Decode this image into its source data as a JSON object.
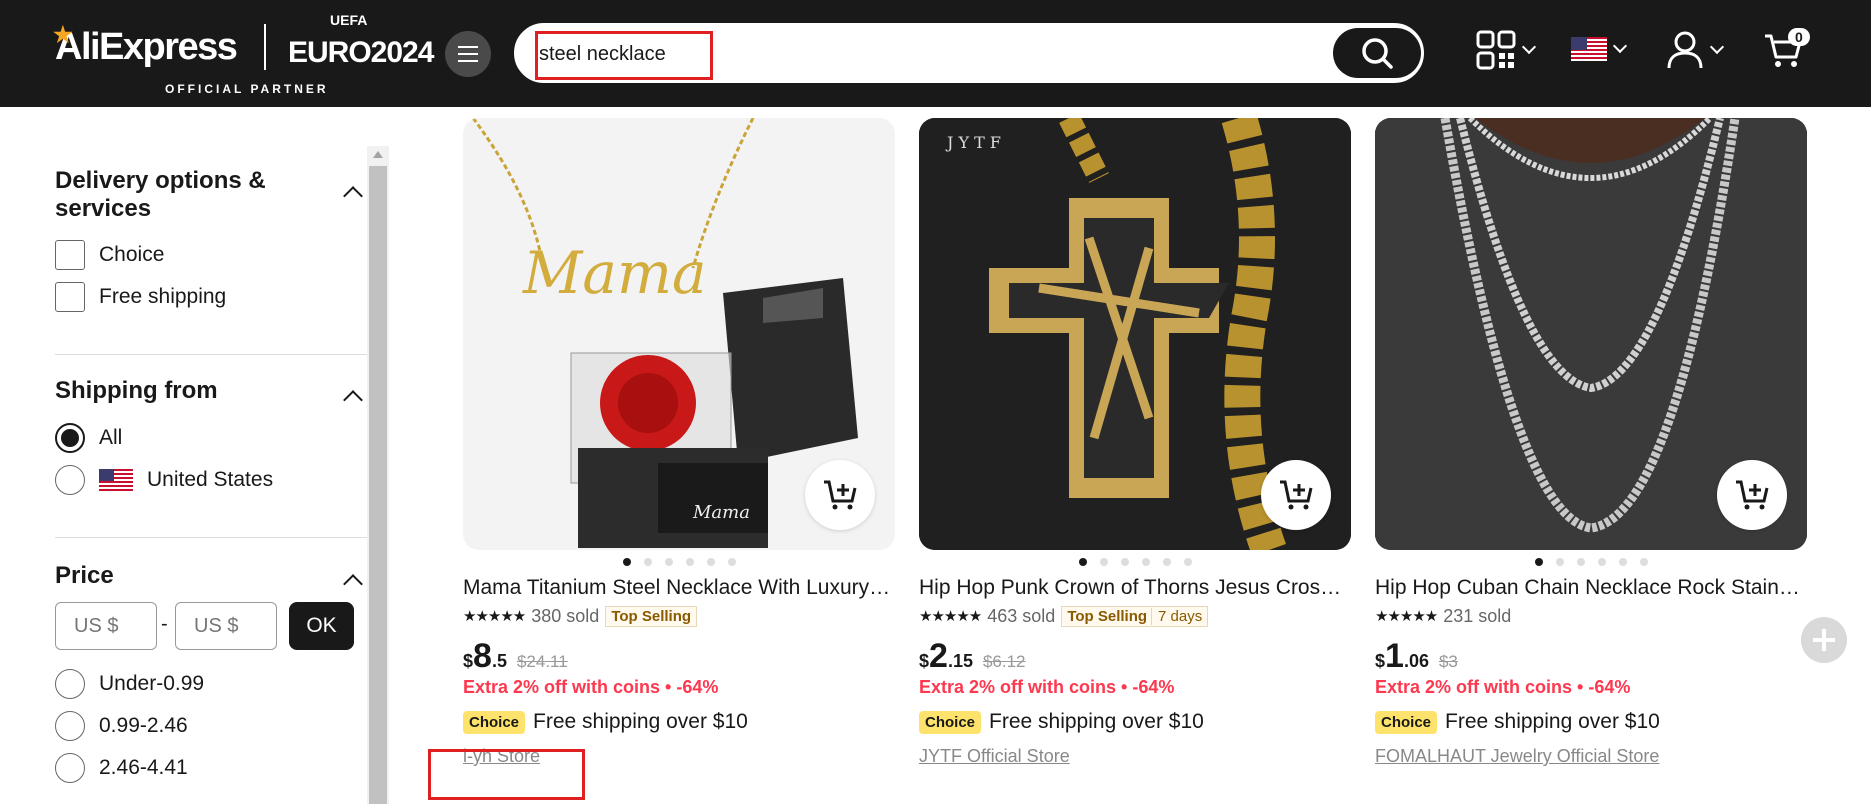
{
  "header": {
    "logo_text": "AliExpress",
    "euro_text": "EURO2024",
    "uefa_text": "UEFA",
    "partner_text": "OFFICIAL PARTNER",
    "search_value": "steel necklace",
    "cart_count": "0",
    "icons": [
      "menu-icon",
      "search-icon",
      "qr-code-icon",
      "us-flag-icon",
      "user-icon",
      "cart-icon"
    ]
  },
  "sidebar": {
    "delivery": {
      "title": "Delivery options & services",
      "options": [
        "Choice",
        "Free shipping"
      ]
    },
    "shipping_from": {
      "title": "Shipping from",
      "options": [
        "All",
        "United States"
      ],
      "selected": "All"
    },
    "price": {
      "title": "Price",
      "min_placeholder": "US $",
      "max_placeholder": "US $",
      "dash": "-",
      "ok_label": "OK",
      "ranges": [
        "Under-0.99",
        "0.99-2.46",
        "2.46-4.41"
      ]
    }
  },
  "products": [
    {
      "title": "Mama Titanium Steel Necklace With Luxury Gift Box Mother's Day",
      "rating_stars": "★★★★★",
      "sold": "380 sold",
      "tag": "Top Selling",
      "tag_extra": "",
      "currency": "$",
      "price_int": "8",
      "price_dec": ".5",
      "old_price": "$24.11",
      "coins": "Extra 2% off with coins • -64%",
      "choice": "Choice",
      "shipping": "Free shipping over $10",
      "store": "l-yh Store"
    },
    {
      "title": "Hip Hop Punk Crown of Thorns Jesus Cross Pendant Necklace",
      "rating_stars": "★★★★★",
      "sold": "463 sold",
      "tag": "Top Selling",
      "tag_extra": "7 days",
      "currency": "$",
      "price_int": "2",
      "price_dec": ".15",
      "old_price": "$6.12",
      "coins": "Extra 2% off with coins • -64%",
      "choice": "Choice",
      "shipping": "Free shipping over $10",
      "store": "JYTF Official Store"
    },
    {
      "title": "Hip Hop Cuban Chain Necklace Rock Stainless Steel Men Jewelry",
      "rating_stars": "★★★★★",
      "sold": "231 sold",
      "tag": "",
      "tag_extra": "",
      "currency": "$",
      "price_int": "1",
      "price_dec": ".06",
      "old_price": "$3",
      "coins": "Extra 2% off with coins • -64%",
      "choice": "Choice",
      "shipping": "Free shipping over $10",
      "store": "FOMALHAUT Jewelry Official Store"
    }
  ],
  "colors": {
    "header_bg": "#191919",
    "sale_red": "#fd384f",
    "choice_yellow": "#fde36c",
    "highlight_red": "#e02020"
  }
}
